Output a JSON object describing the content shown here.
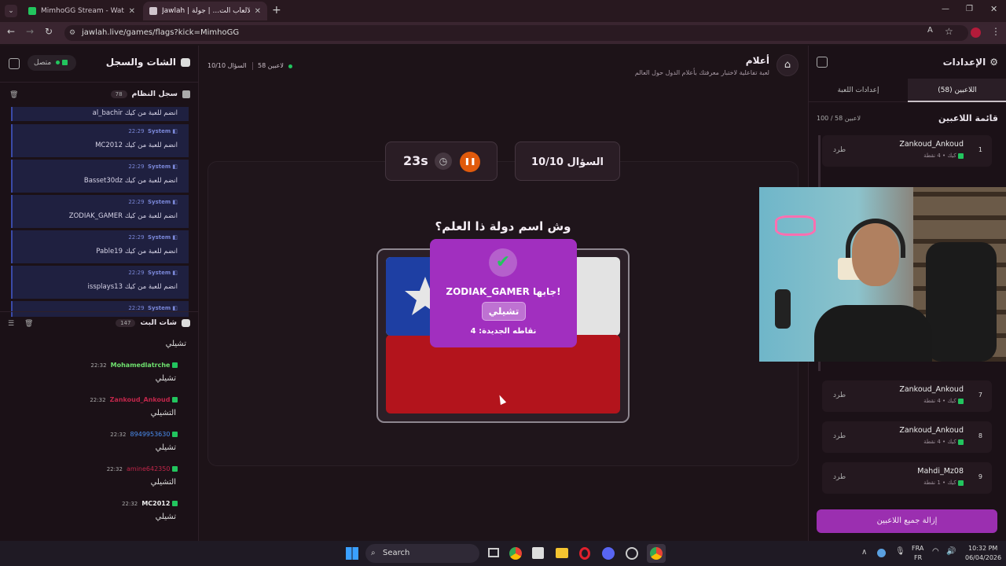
{
  "tabs": [
    {
      "label": "MimhoGG Stream - Watch Live"
    },
    {
      "label": "Jawlah | منصة الألعاب الت... | جولة"
    }
  ],
  "url": "jawlah.live/games/flags?kick=MimhoGG",
  "left": {
    "title": "الشات والسجل",
    "status": "متصل",
    "syslog_title": "سجل النظام",
    "syslog_count": "78",
    "first_line": "al_bachir انضم للعبة من كيك",
    "sys_msgs": [
      {
        "time": "22:29",
        "sender": "System",
        "text": "MC2012 انضم للعبة من كيك"
      },
      {
        "time": "22:29",
        "sender": "System",
        "text": "Basset30dz انضم للعبة من كيك"
      },
      {
        "time": "22:29",
        "sender": "System",
        "text": "ZODIAK_GAMER انضم للعبة من كيك"
      },
      {
        "time": "22:29",
        "sender": "System",
        "text": "Pable19 انضم للعبة من كيك"
      },
      {
        "time": "22:29",
        "sender": "System",
        "text": "issplays13 انضم للعبة من كيك"
      }
    ],
    "sys_partial": {
      "time": "22:29",
      "sender": "System"
    },
    "chat_title": "شات البث",
    "chat_count": "147",
    "chat_first": "تشيلي",
    "chat": [
      {
        "time": "22:32",
        "user": "Mohamedlatrche",
        "color": "#6ee06e",
        "text": "تشيلي"
      },
      {
        "time": "22:32",
        "user": "Zankoud_Ankoud",
        "color": "#c0264a",
        "text": "التشيلي"
      },
      {
        "time": "22:32",
        "user": "8949953630",
        "color": "#4a8ef0",
        "text": "تشيلي"
      },
      {
        "time": "22:32",
        "user": "amine642350",
        "color": "#c0264a",
        "text": "التشيلي"
      },
      {
        "time": "22:32",
        "user": "MC2012",
        "color": "#e8e8e8",
        "text": "تشيلي"
      }
    ]
  },
  "header": {
    "game_title": "أعلام",
    "game_sub": "لعبة تفاعلية لاختبار معرفتك بأعلام الدول حول العالم",
    "players": "58 لاعبين",
    "question_short": "السؤال 10/10"
  },
  "game": {
    "timer": "23s",
    "question_box": "السؤال 10/10",
    "question": "وش اسم دولة ذا العلم؟"
  },
  "popup": {
    "winner": "ZODIAK_GAMER جابها!",
    "answer": "تشيلي",
    "points": "نقاطه الجديدة: 4"
  },
  "flag": {
    "blue": "#1e3fa3",
    "white": "#e3e3e3",
    "red": "#b3141c"
  },
  "right": {
    "title": "الإعدادات",
    "tab_players": "اللاعبين (58)",
    "tab_settings": "إعدادات اللعبة",
    "list_title": "قائمة اللاعبين",
    "list_count": "100 / 58 لاعبين",
    "kick": "طرد",
    "players": [
      {
        "rank": "1",
        "name": "Zankoud_Ankoud",
        "sub": "كيك • 4 نقطة"
      },
      {
        "rank": "7",
        "name": "Zankoud_Ankoud",
        "sub": "كيك • 4 نقطة"
      },
      {
        "rank": "8",
        "name": "Zankoud_Ankoud",
        "sub": "كيك • 4 نقطة"
      },
      {
        "rank": "9",
        "name": "Mahdi_Mz08",
        "sub": "كيك • 1 نقطة"
      }
    ],
    "remove_all": "إزالة جميع اللاعبين"
  },
  "taskbar": {
    "search": "Search",
    "lang1": "FRA",
    "lang2": "FR",
    "time": "10:32 PM",
    "date": "06/04/2026"
  },
  "colors": {
    "accent": "#9b2fb0",
    "popup": "#a12fbf",
    "orange": "#e05a0c"
  }
}
